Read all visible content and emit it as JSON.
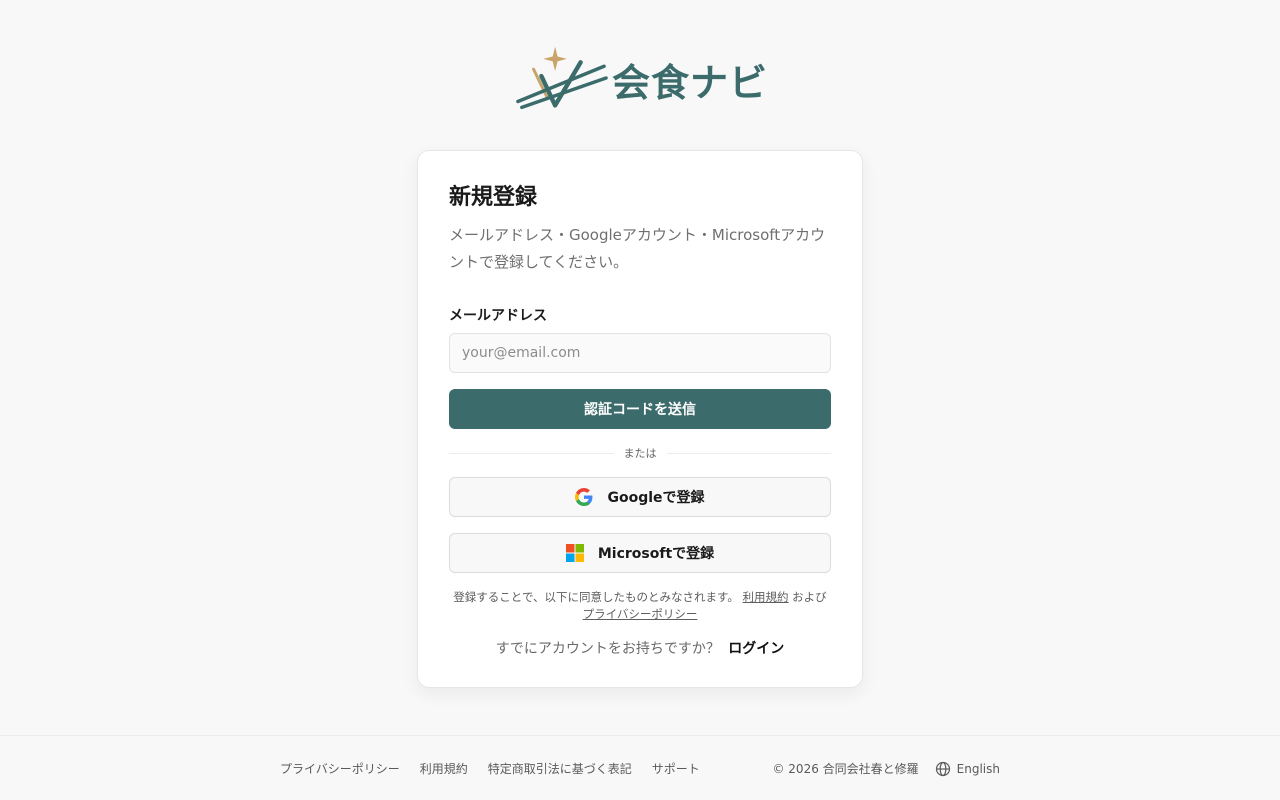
{
  "brand": {
    "name": "会食ナビ",
    "primary_color": "#3b6b6b",
    "accent_color": "#c9a46a"
  },
  "signup": {
    "title": "新規登録",
    "subtitle": "メールアドレス・Googleアカウント・Microsoftアカウントで登録してください。",
    "email_label": "メールアドレス",
    "email_placeholder": "your@email.com",
    "email_value": "",
    "send_code_label": "認証コードを送信",
    "divider_text": "または",
    "google_label": "Googleで登録",
    "microsoft_label": "Microsoftで登録",
    "terms": {
      "prefix": "登録することで、以下に同意したものとみなされます。",
      "terms_link": "利用規約",
      "and": "および",
      "privacy_link": "プライバシーポリシー"
    },
    "login_prompt": "すでにアカウントをお持ちですか？",
    "login_link": "ログイン"
  },
  "footer": {
    "links": [
      "プライバシーポリシー",
      "利用規約",
      "特定商取引法に基づく表記",
      "サポート"
    ],
    "copyright": "© 2026 合同会社春と修羅",
    "language": "English"
  }
}
